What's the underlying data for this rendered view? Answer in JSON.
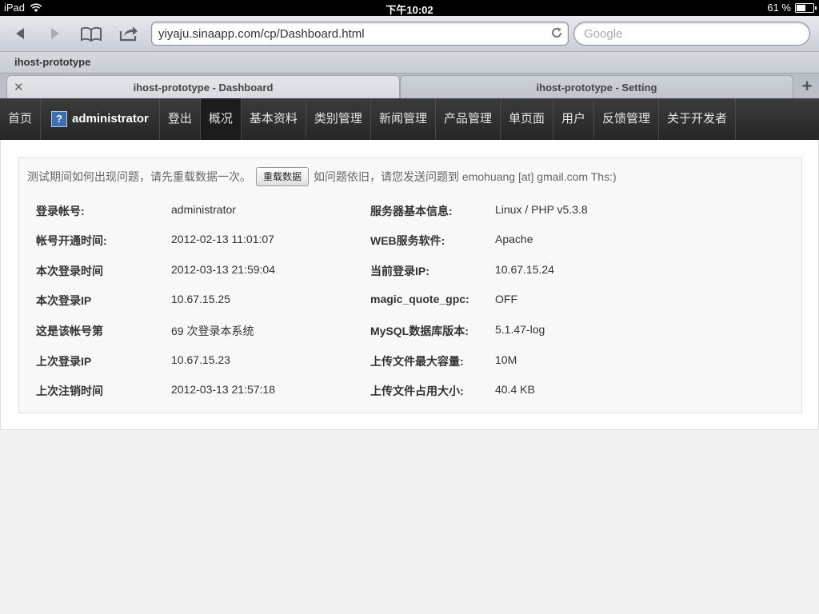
{
  "status_bar": {
    "device": "iPad",
    "time": "下午10:02",
    "battery": "61 %",
    "battery_level": 0.61
  },
  "browser": {
    "url": "yiyaju.sinaapp.com/cp/Dashboard.html",
    "search_placeholder": "Google",
    "bookmark": "ihost-prototype",
    "tabs": [
      {
        "label": "ihost-prototype - Dashboard",
        "active": true
      },
      {
        "label": "ihost-prototype - Setting",
        "active": false
      }
    ]
  },
  "nav": {
    "home": "首页",
    "user": "administrator",
    "items": [
      "登出",
      "概况",
      "基本资料",
      "类别管理",
      "新闻管理",
      "产品管理",
      "单页面",
      "用户",
      "反馈管理",
      "关于开发者"
    ]
  },
  "notice": {
    "prefix": "测试期间如何出现问题，请先重载数据一次。",
    "button": "重载数据",
    "suffix": "如问题依旧，请您发送问题到 emohuang [at] gmail.com Ths:)"
  },
  "info_left": [
    {
      "label": "登录帐号:",
      "value": "administrator"
    },
    {
      "label": "帐号开通时间:",
      "value": "2012-02-13 11:01:07"
    },
    {
      "label": "本次登录时间",
      "value": "2012-03-13 21:59:04"
    },
    {
      "label": "本次登录IP",
      "value": "10.67.15.25"
    },
    {
      "label": "这是该帐号第",
      "value": "69 次登录本系统"
    },
    {
      "label": "上次登录IP",
      "value": "10.67.15.23"
    },
    {
      "label": "上次注销时间",
      "value": "2012-03-13 21:57:18"
    }
  ],
  "info_right": [
    {
      "label": "服务器基本信息:",
      "value": "Linux / PHP v5.3.8"
    },
    {
      "label": "WEB服务软件:",
      "value": "Apache"
    },
    {
      "label": "当前登录IP:",
      "value": "10.67.15.24"
    },
    {
      "label": "magic_quote_gpc:",
      "value": "OFF"
    },
    {
      "label": "MySQL数据库版本:",
      "value": "5.1.47-log"
    },
    {
      "label": "上传文件最大容量:",
      "value": "10M"
    },
    {
      "label": "上传文件占用大小:",
      "value": "40.4 KB"
    }
  ]
}
